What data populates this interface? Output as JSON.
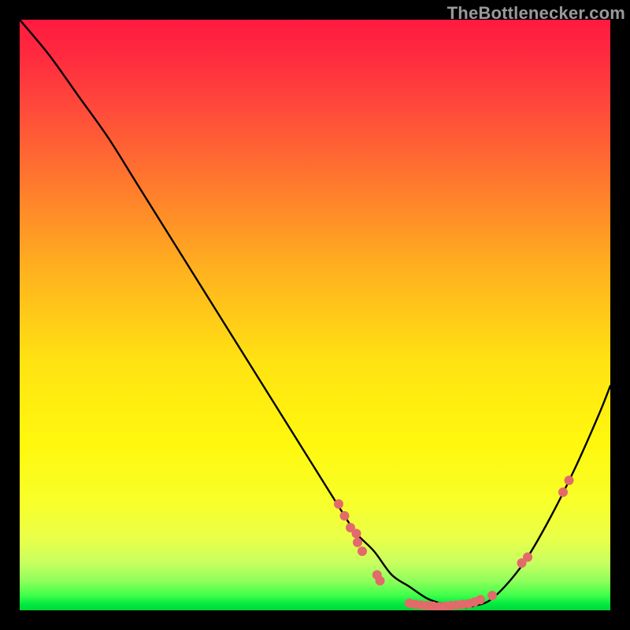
{
  "attribution": "TheBottlenecker.com",
  "chart_data": {
    "type": "line",
    "title": "",
    "xlabel": "",
    "ylabel": "",
    "xlim": [
      0,
      100
    ],
    "ylim": [
      0,
      100
    ],
    "x": [
      0,
      5,
      10,
      15,
      20,
      25,
      30,
      35,
      40,
      45,
      50,
      55,
      57,
      60,
      63,
      66,
      69,
      72,
      75,
      78,
      80,
      83,
      86,
      90,
      94,
      98,
      100
    ],
    "values": [
      100,
      94,
      87,
      80,
      72,
      64,
      56,
      48,
      40,
      32,
      24,
      16,
      13,
      10,
      6,
      4,
      2,
      1,
      0.5,
      1,
      2,
      5,
      9,
      16,
      24,
      33,
      38
    ],
    "markers": [
      {
        "x": 54,
        "y": 18
      },
      {
        "x": 55,
        "y": 16
      },
      {
        "x": 56,
        "y": 14
      },
      {
        "x": 57,
        "y": 13
      },
      {
        "x": 57.2,
        "y": 11.5
      },
      {
        "x": 58,
        "y": 10
      },
      {
        "x": 60.5,
        "y": 6
      },
      {
        "x": 61,
        "y": 5
      },
      {
        "x": 66,
        "y": 1.2
      },
      {
        "x": 67,
        "y": 1
      },
      {
        "x": 68,
        "y": 0.9
      },
      {
        "x": 69,
        "y": 0.8
      },
      {
        "x": 70,
        "y": 0.7
      },
      {
        "x": 71,
        "y": 0.6
      },
      {
        "x": 72,
        "y": 0.7
      },
      {
        "x": 73,
        "y": 0.8
      },
      {
        "x": 74,
        "y": 0.9
      },
      {
        "x": 75,
        "y": 1.0
      },
      {
        "x": 76,
        "y": 1.1
      },
      {
        "x": 77,
        "y": 1.4
      },
      {
        "x": 78,
        "y": 1.8
      },
      {
        "x": 80,
        "y": 2.5
      },
      {
        "x": 85,
        "y": 8
      },
      {
        "x": 86,
        "y": 9
      },
      {
        "x": 92,
        "y": 20
      },
      {
        "x": 93,
        "y": 22
      }
    ]
  }
}
